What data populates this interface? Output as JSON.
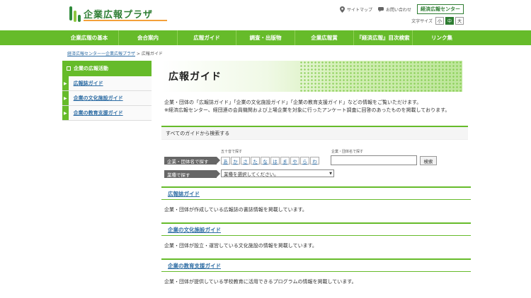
{
  "header": {
    "logo_text": "企業広報プラザ",
    "sitemap": "サイトマップ",
    "contact": "お問い合わせ",
    "cta": "経済広報センター",
    "font_size_label": "文字サイズ",
    "font_sizes": [
      "小",
      "中",
      "大"
    ],
    "font_size_selected": "中"
  },
  "nav": [
    "企業広報の基本",
    "会合案内",
    "広報ガイド",
    "調査・出版物",
    "企業広報賞",
    "『経済広報』目次検索",
    "リンク集"
  ],
  "breadcrumb": {
    "link": "経済広報センター一企業広報プラザ",
    "separator": " > ",
    "current": "広報ガイド"
  },
  "sidebar": {
    "head": "企業の広報活動",
    "items": [
      "広報誌ガイド",
      "企業の文化施設ガイド",
      "企業の教育支援ガイド"
    ]
  },
  "page": {
    "title": "広報ガイド",
    "intro_1": "企業・団体の「広報誌ガイド」「企業の文化施設ガイド」「企業の教育支援ガイド」などの情報をご覧いただけます。",
    "intro_2": "※経済広報センター、経団連の会員機関および上場企業を対象に行ったアンケート調査に回答のあったものを掲載しております。"
  },
  "search": {
    "heading": "すべてのガイドから検索する",
    "kana_caption": "五十音で探す",
    "name_caption": "企業・団体名で探す",
    "name_tag": "企業・団体名で探す",
    "kana": [
      "あ",
      "か",
      "さ",
      "た",
      "な",
      "は",
      "ま",
      "や",
      "ら",
      "わ"
    ],
    "button": "検索",
    "industry_tag": "業種で探す",
    "industry_placeholder": "業種を選択してください。"
  },
  "sections": [
    {
      "title": "広報誌ガイド",
      "desc": "企業・団体が作成している広報誌の書誌情報を掲載しています。"
    },
    {
      "title": "企業の文化施設ガイド",
      "desc": "企業・団体が設立・運営している文化施設の情報を掲載しています。"
    },
    {
      "title": "企業の教育支援ガイド",
      "desc": "企業・団体が提供している学校教育に活用できるプログラムの情報を掲載しています。"
    }
  ],
  "colors": {
    "accent": "#66bb2a",
    "brand": "#2e7d32",
    "link": "#2e6da4"
  }
}
